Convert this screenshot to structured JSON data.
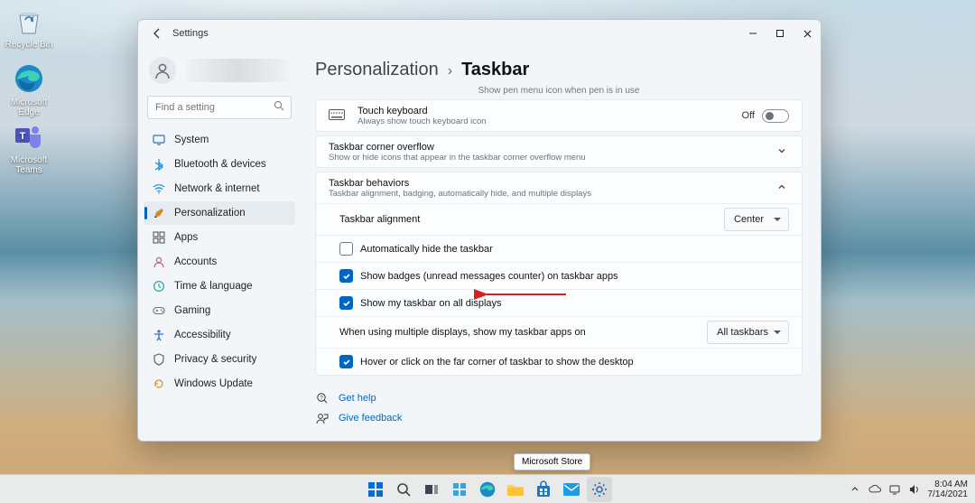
{
  "desktop": {
    "icons": [
      {
        "label": "Recycle Bin",
        "name": "recycle-bin"
      },
      {
        "label": "Microsoft Edge",
        "name": "microsoft-edge"
      },
      {
        "label": "Microsoft Teams",
        "name": "microsoft-teams"
      }
    ]
  },
  "window": {
    "title": "Settings",
    "search_placeholder": "Find a setting",
    "nav": [
      {
        "label": "System",
        "icon": "system-icon",
        "id": "system"
      },
      {
        "label": "Bluetooth & devices",
        "icon": "bluetooth-icon",
        "id": "bluetooth"
      },
      {
        "label": "Network & internet",
        "icon": "wifi-icon",
        "id": "network"
      },
      {
        "label": "Personalization",
        "icon": "personalization-icon",
        "id": "personalization",
        "active": true
      },
      {
        "label": "Apps",
        "icon": "apps-icon",
        "id": "apps"
      },
      {
        "label": "Accounts",
        "icon": "accounts-icon",
        "id": "accounts"
      },
      {
        "label": "Time & language",
        "icon": "time-icon",
        "id": "time"
      },
      {
        "label": "Gaming",
        "icon": "gaming-icon",
        "id": "gaming"
      },
      {
        "label": "Accessibility",
        "icon": "accessibility-icon",
        "id": "accessibility"
      },
      {
        "label": "Privacy & security",
        "icon": "privacy-icon",
        "id": "privacy"
      },
      {
        "label": "Windows Update",
        "icon": "update-icon",
        "id": "update"
      }
    ],
    "breadcrumb": {
      "parent": "Personalization",
      "current": "Taskbar"
    },
    "truncated_hint": "Show pen menu icon when pen is in use",
    "touch_keyboard": {
      "title": "Touch keyboard",
      "desc": "Always show touch keyboard icon",
      "state": "Off"
    },
    "overflow": {
      "title": "Taskbar corner overflow",
      "desc": "Show or hide icons that appear in the taskbar corner overflow menu"
    },
    "behaviors": {
      "title": "Taskbar behaviors",
      "desc": "Taskbar alignment, badging, automatically hide, and multiple displays",
      "alignment": {
        "label": "Taskbar alignment",
        "value": "Center"
      },
      "opts": {
        "auto_hide": {
          "label": "Automatically hide the taskbar",
          "checked": false
        },
        "badges": {
          "label": "Show badges (unread messages counter) on taskbar apps",
          "checked": true
        },
        "all_displays": {
          "label": "Show my taskbar on all displays",
          "checked": true
        },
        "multi_label": "When using multiple displays, show my taskbar apps on",
        "multi_value": "All taskbars",
        "far_corner": {
          "label": "Hover or click on the far corner of taskbar to show the desktop",
          "checked": true
        }
      }
    },
    "help": {
      "get_help": "Get help",
      "feedback": "Give feedback"
    }
  },
  "taskbar": {
    "tooltip": "Microsoft Store",
    "clock": {
      "time": "8:04 AM",
      "date": "7/14/2021"
    }
  }
}
